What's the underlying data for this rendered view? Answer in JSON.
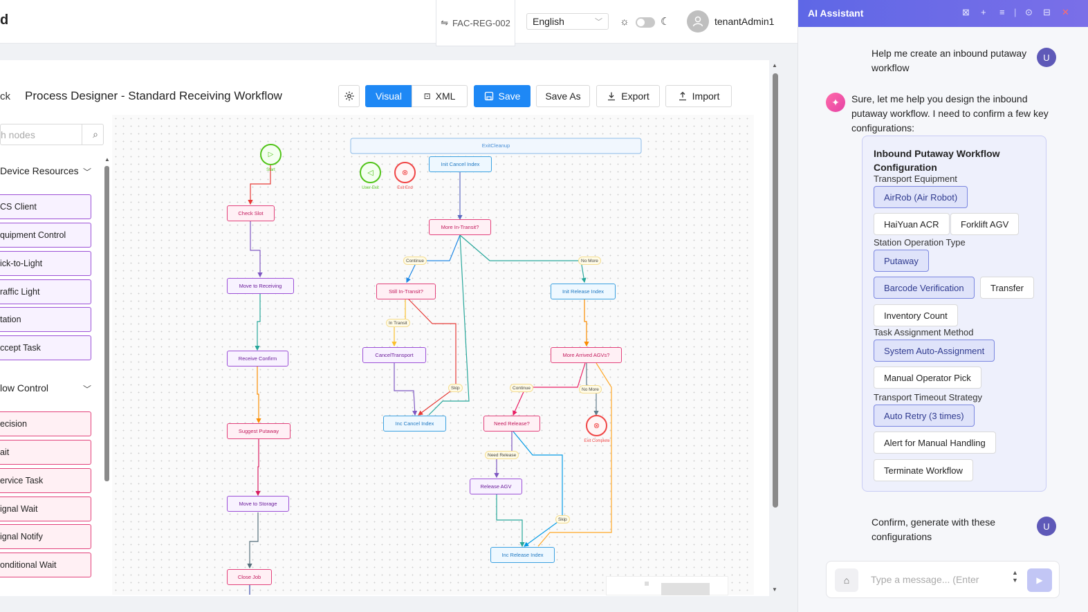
{
  "header": {
    "app_title": "d",
    "facility": "FAC-REG-002",
    "language": "English",
    "username": "tenantAdmin1"
  },
  "designer": {
    "back_label": "ck",
    "title": "Process Designer - Standard Receiving Workflow",
    "tabs": {
      "visual": "Visual",
      "xml": "XML"
    },
    "actions": {
      "save": "Save",
      "save_as": "Save As",
      "export": "Export",
      "import": "Import"
    }
  },
  "palette": {
    "search_placeholder": "h nodes",
    "device_section": "Device Resources",
    "device_items": [
      "CS Client",
      "quipment Control",
      "ick-to-Light",
      "raffic Light",
      "tation",
      "ccept Task"
    ],
    "flow_section": "low Control",
    "flow_items": [
      "ecision",
      "ait",
      "ervice Task",
      "ignal Wait",
      "ignal Notify",
      "onditional Wait"
    ]
  },
  "flow": {
    "nodes": {
      "start": "Start",
      "check_slot": "Check Slot",
      "move_receiving": "Move to Receiving",
      "receive_confirm": "Receive Confirm",
      "suggest_putaway": "Suggest Putaway",
      "move_storage": "Move to Storage",
      "close_job": "Close Job",
      "exit_cleanup": "ExitCleanup",
      "user_exit": "User-Exit",
      "exit_end": "Exit End",
      "init_cancel": "Init Cancel Index",
      "more_in_transit": "More In-Transit?",
      "still_in_transit": "Still In-Transit?",
      "cancel_transport": "CancelTransport",
      "inc_cancel": "Inc Cancel Index",
      "init_release": "Init Release Index",
      "more_arrived": "More Arrived AGVs?",
      "need_release": "Need Release?",
      "release_agv": "Release AGV",
      "inc_release": "Inc Release Index",
      "exit_complete": "Exit Complete"
    },
    "edges": {
      "continue1": "Continue",
      "no_more1": "No More",
      "in_transit": "In Transit",
      "skip1": "Skip",
      "continue2": "Continue",
      "no_more2": "No More",
      "need_release": "Need Release",
      "skip2": "Skip"
    }
  },
  "assistant": {
    "title": "AI Assistant",
    "user_initial": "U",
    "user_msg1": "Help me create an inbound putaway workflow",
    "bot_msg": "Sure, let me help you design the inbound putaway workflow. I need to confirm a few key configurations:",
    "config_title": "Inbound Putaway Workflow Configuration",
    "groups": {
      "transport": "Transport Equipment",
      "station": "Station Operation Type",
      "assignment": "Task Assignment Method",
      "timeout": "Transport Timeout Strategy"
    },
    "options": {
      "airrob": "AirRob (Air Robot)",
      "haiyuan": "HaiYuan ACR",
      "forklift": "Forklift AGV",
      "putaway": "Putaway",
      "barcode": "Barcode Verification",
      "transfer": "Transfer",
      "inventory": "Inventory Count",
      "auto_assign": "System Auto-Assignment",
      "manual_pick": "Manual Operator Pick",
      "auto_retry": "Auto Retry (3 times)",
      "alert": "Alert for Manual Handling",
      "terminate": "Terminate Workflow"
    },
    "user_msg2": "Confirm, generate with these configurations",
    "input_placeholder": "Type a message... (Enter"
  },
  "colors": {
    "primary": "#1e88f5",
    "assistant_header": "#6a6ce8",
    "flow_node_pink": "#e2407a",
    "flow_node_purple": "#9b4fd6",
    "flow_node_blue": "#3aa0e0",
    "start_green": "#52c41a",
    "end_red": "#f04545"
  }
}
